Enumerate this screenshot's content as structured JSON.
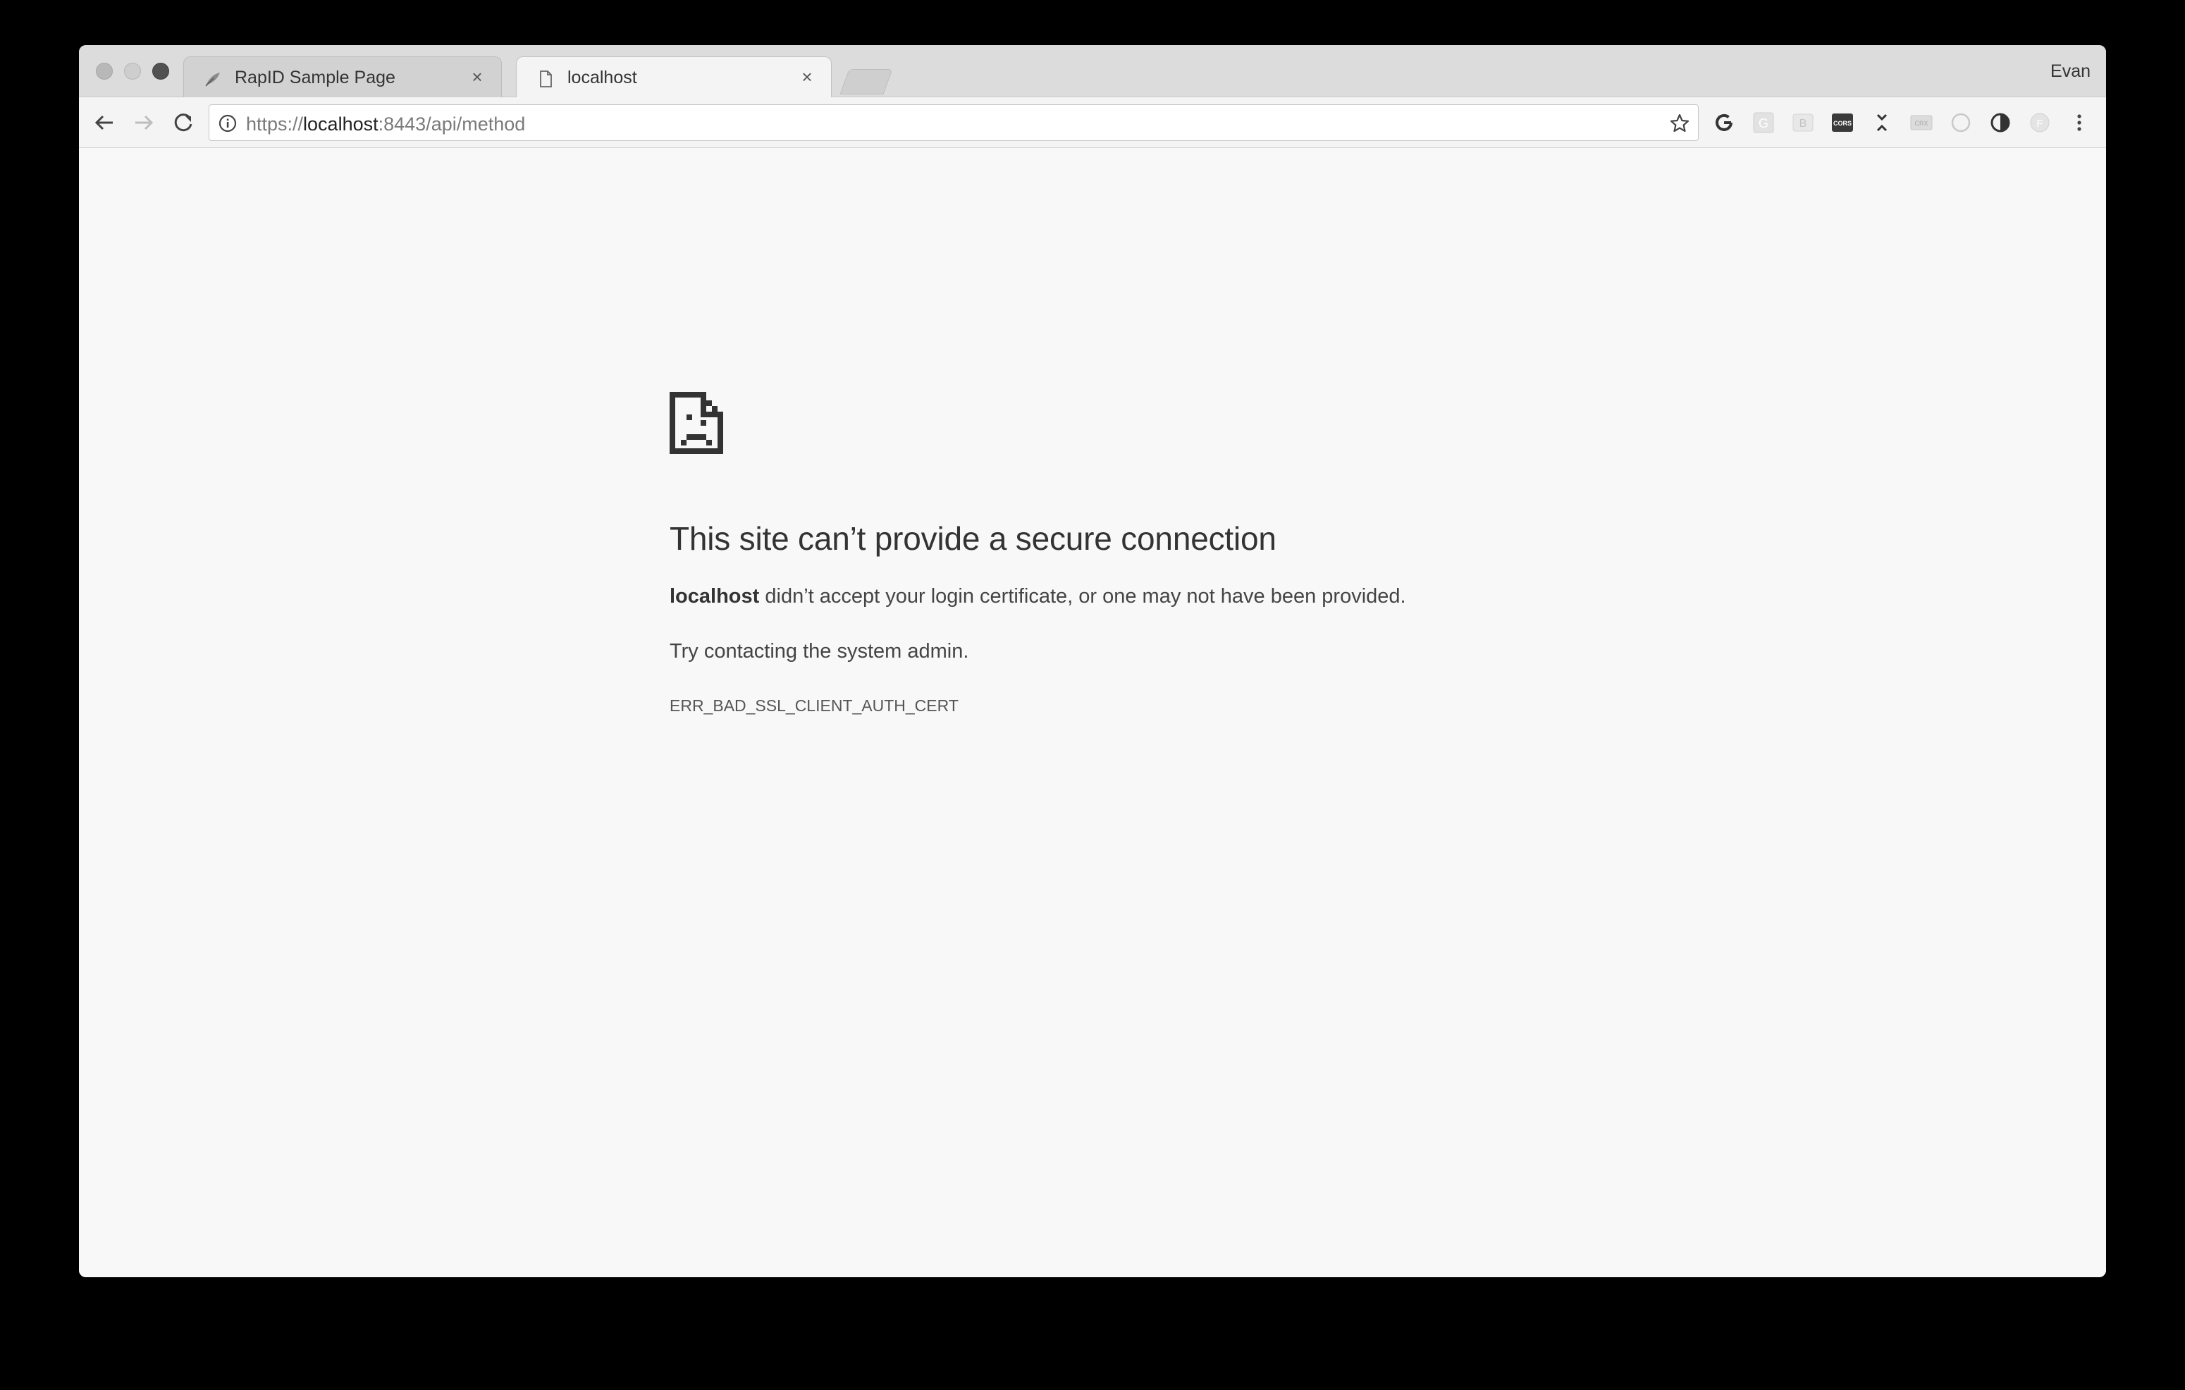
{
  "tabs": [
    {
      "title": "RapID Sample Page",
      "icon": "feather-icon",
      "active": false
    },
    {
      "title": "localhost",
      "icon": "document-icon",
      "active": true
    }
  ],
  "profile": {
    "name": "Evan"
  },
  "omnibox": {
    "scheme": "https://",
    "host": "localhost",
    "rest": ":8443/api/method"
  },
  "extensions": [
    {
      "name": "google-extension-icon",
      "label": ""
    },
    {
      "name": "g-extension-icon",
      "label": "G"
    },
    {
      "name": "b-extension-icon",
      "label": "B"
    },
    {
      "name": "cors-extension-icon",
      "label": "CORS"
    },
    {
      "name": "collapse-extension-icon",
      "label": ""
    },
    {
      "name": "crx-extension-icon",
      "label": "CRX"
    },
    {
      "name": "circle-extension-icon",
      "label": ""
    },
    {
      "name": "contrast-extension-icon",
      "label": ""
    },
    {
      "name": "f-extension-icon",
      "label": "F"
    }
  ],
  "error": {
    "title": "This site can’t provide a secure connection",
    "host": "localhost",
    "description": " didn’t accept your login certificate, or one may not have been provided.",
    "suggestion": "Try contacting the system admin.",
    "code": "ERR_BAD_SSL_CLIENT_AUTH_CERT"
  },
  "colors": {
    "window_bg": "#f8f8f8",
    "tabstrip_bg": "#dcdcdc",
    "text": "#333333"
  }
}
